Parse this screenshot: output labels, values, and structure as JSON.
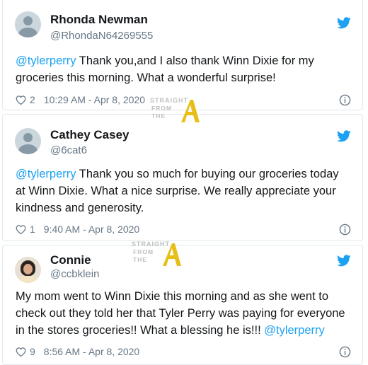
{
  "tweets": [
    {
      "name": "Rhonda Newman",
      "handle": "@RhondaN64269555",
      "text_mention": "@tylerperry",
      "text_body": " Thank you,and I also thank Winn Dixie for my groceries this morning. What a wonderful surprise!",
      "likes": "2",
      "timestamp": "10:29 AM - Apr 8, 2020",
      "avatar": "default-avatar-icon"
    },
    {
      "name": "Cathey Casey",
      "handle": "@6cat6",
      "text_mention": "@tylerperry",
      "text_body": " Thank you so much for buying our groceries today at Winn Dixie.  What a nice surprise.  We really appreciate your kindness and generosity.",
      "likes": "1",
      "timestamp": "9:40 AM - Apr 8, 2020",
      "avatar": "default-avatar-icon"
    },
    {
      "name": "Connie",
      "handle": "@ccbklein",
      "text_body": "My mom went to Winn Dixie this morning and as she went to check out they told her that Tyler Perry was paying for everyone in the stores groceries!! What a blessing he is!!! ",
      "text_mention": "@tylerperry",
      "likes": "9",
      "timestamp": "8:56 AM - Apr 8, 2020",
      "avatar": "profile-photo"
    }
  ],
  "watermark": {
    "line1": "STRAIGHT",
    "line2": "FROM",
    "line3": "THE"
  },
  "colors": {
    "brand_blue": "#1da1f2",
    "muted_gray": "#657786",
    "border": "#e1e8ed",
    "watermark_gold": "#e6b800"
  },
  "icons": {
    "platform": "twitter-bird-icon",
    "like": "heart-icon",
    "info": "info-icon"
  }
}
